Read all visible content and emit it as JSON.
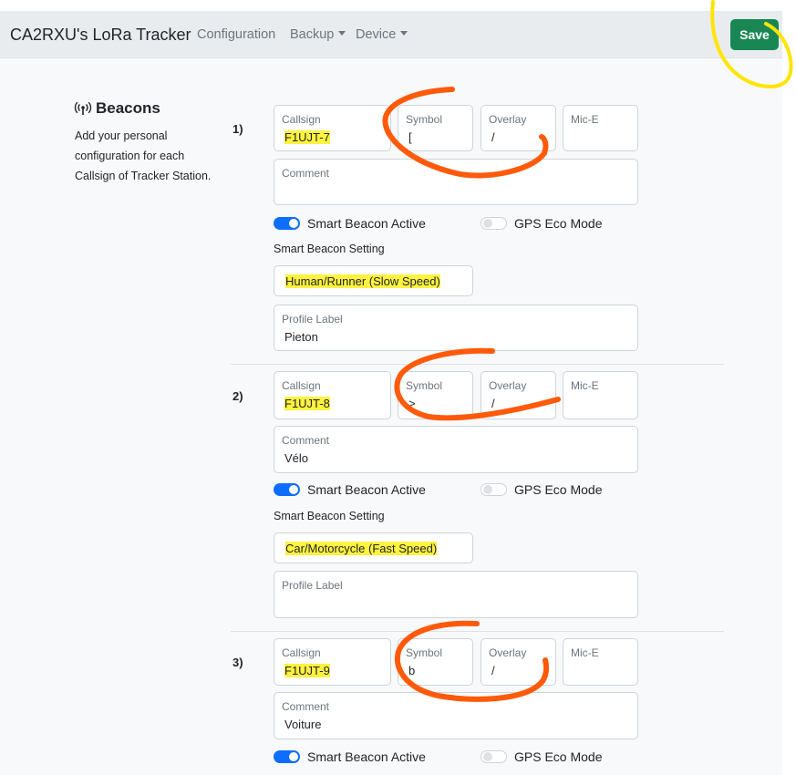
{
  "navbar": {
    "brand": "CA2RXU's LoRa Tracker",
    "items": [
      {
        "label": "Configuration",
        "dropdown": false
      },
      {
        "label": "Backup",
        "dropdown": true
      },
      {
        "label": "Device",
        "dropdown": true
      }
    ],
    "save_label": "Save",
    "save_color": "#198754"
  },
  "section": {
    "icon": "broadcast-icon",
    "title": "Beacons",
    "description": "Add your personal configuration for each Callsign of Tracker Station."
  },
  "labels": {
    "callsign": "Callsign",
    "symbol": "Symbol",
    "overlay": "Overlay",
    "mic_e": "Mic-E",
    "comment": "Comment",
    "smart_beacon_active": "Smart Beacon Active",
    "gps_eco_mode": "GPS Eco Mode",
    "smart_beacon_setting": "Smart Beacon Setting",
    "profile_label": "Profile Label"
  },
  "beacons": [
    {
      "number": "1)",
      "callsign": "F1UJT-7",
      "symbol": "[",
      "overlay": "/",
      "mic_e": "",
      "comment": "",
      "smart_beacon_active": true,
      "gps_eco_mode": false,
      "smart_beacon_setting": "Human/Runner (Slow Speed)",
      "profile_label": "Pieton"
    },
    {
      "number": "2)",
      "callsign": "F1UJT-8",
      "symbol": ">",
      "overlay": "/",
      "mic_e": "",
      "comment": "Vélo",
      "smart_beacon_active": true,
      "gps_eco_mode": false,
      "smart_beacon_setting": "Car/Motorcycle (Fast Speed)",
      "profile_label": ""
    },
    {
      "number": "3)",
      "callsign": "F1UJT-9",
      "symbol": "b",
      "overlay": "/",
      "mic_e": "",
      "comment": "Voiture",
      "smart_beacon_active": true,
      "gps_eco_mode": false
    }
  ],
  "colors": {
    "switch_on": "#0d6efd",
    "highlight": "#ffee00",
    "annotation_orange": "#ff5a0a",
    "annotation_yellow": "#ffe500"
  }
}
